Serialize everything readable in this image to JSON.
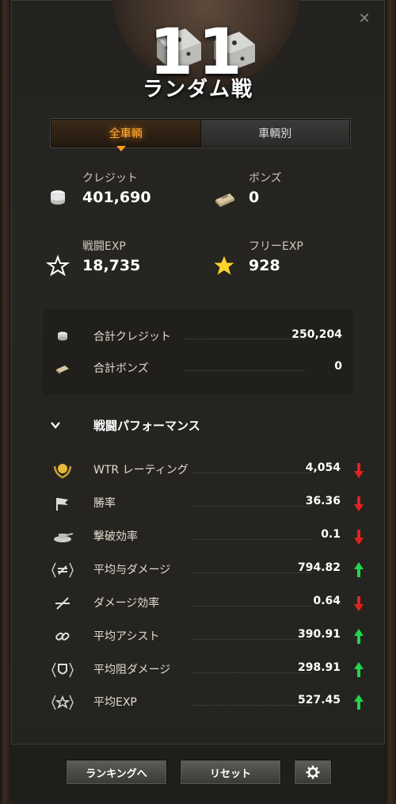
{
  "header": {
    "tier_number": "11",
    "battle_type": "ランダム戦",
    "close_icon": "close-icon"
  },
  "tabs": [
    {
      "label": "全車輌",
      "active": true
    },
    {
      "label": "車輌別",
      "active": false
    }
  ],
  "summary": {
    "credits": {
      "label": "クレジット",
      "value": "401,690",
      "icon": "credits-icon"
    },
    "bonds": {
      "label": "ボンズ",
      "value": "0",
      "icon": "bonds-icon"
    },
    "battle_exp": {
      "label": "戦闘EXP",
      "value": "18,735",
      "icon": "star-outline-icon"
    },
    "free_exp": {
      "label": "フリーEXP",
      "value": "928",
      "icon": "star-gold-icon"
    }
  },
  "totals": [
    {
      "label": "合計クレジット",
      "value": "250,204",
      "icon": "credits-icon"
    },
    {
      "label": "合計ボンズ",
      "value": "0",
      "icon": "bonds-icon"
    }
  ],
  "performance": {
    "title": "戦闘パフォーマンス",
    "rows": [
      {
        "label": "WTR レーティング",
        "value": "4,054",
        "trend": "down",
        "icon": "wtr-laurel-icon"
      },
      {
        "label": "勝率",
        "value": "36.36",
        "trend": "down",
        "icon": "flag-icon"
      },
      {
        "label": "撃破効率",
        "value": "0.1",
        "trend": "down",
        "icon": "destroyed-tank-icon"
      },
      {
        "label": "平均与ダメージ",
        "value": "794.82",
        "trend": "up",
        "icon": "damage-dealt-icon"
      },
      {
        "label": "ダメージ効率",
        "value": "0.64",
        "trend": "down",
        "icon": "damage-ratio-icon"
      },
      {
        "label": "平均アシスト",
        "value": "390.91",
        "trend": "up",
        "icon": "assist-icon"
      },
      {
        "label": "平均阻ダメージ",
        "value": "298.91",
        "trend": "up",
        "icon": "blocked-damage-icon"
      },
      {
        "label": "平均EXP",
        "value": "527.45",
        "trend": "up",
        "icon": "exp-star-icon"
      }
    ]
  },
  "footer": {
    "ranking_button": "ランキングへ",
    "reset_button": "リセット",
    "settings_icon": "gear-icon"
  },
  "colors": {
    "accent": "#ffb236",
    "up": "#21d64a",
    "down": "#e0231c"
  }
}
